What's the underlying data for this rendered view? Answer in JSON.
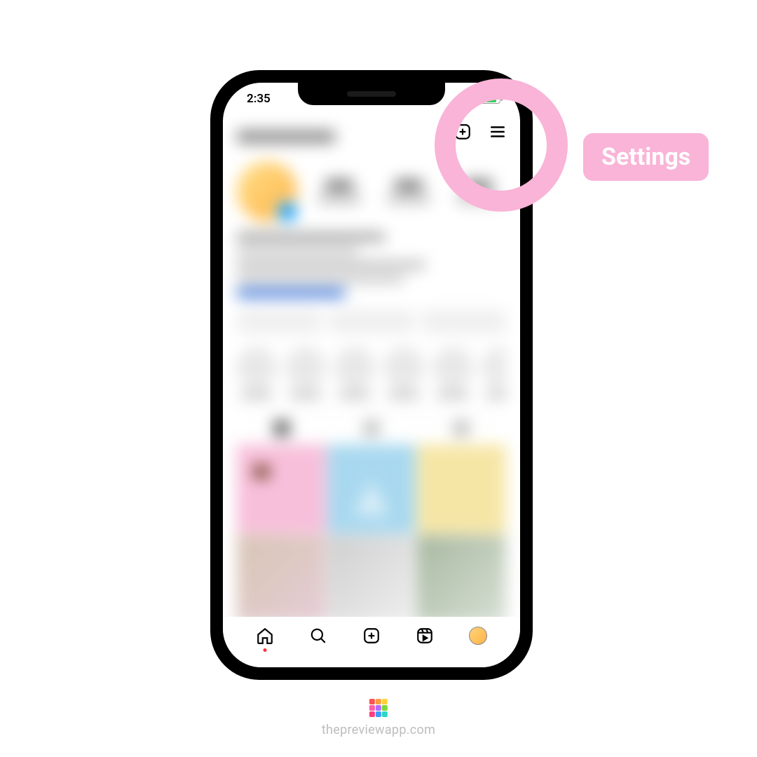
{
  "status": {
    "time": "2:35"
  },
  "annotation": {
    "label": "Settings"
  },
  "watermark": {
    "text": "thepreviewapp.com"
  },
  "icons": {
    "create": "create-post-icon",
    "menu": "hamburger-menu-icon",
    "home": "home-icon",
    "search": "search-icon",
    "add": "add-icon",
    "reels": "reels-icon",
    "profile": "profile-avatar"
  }
}
